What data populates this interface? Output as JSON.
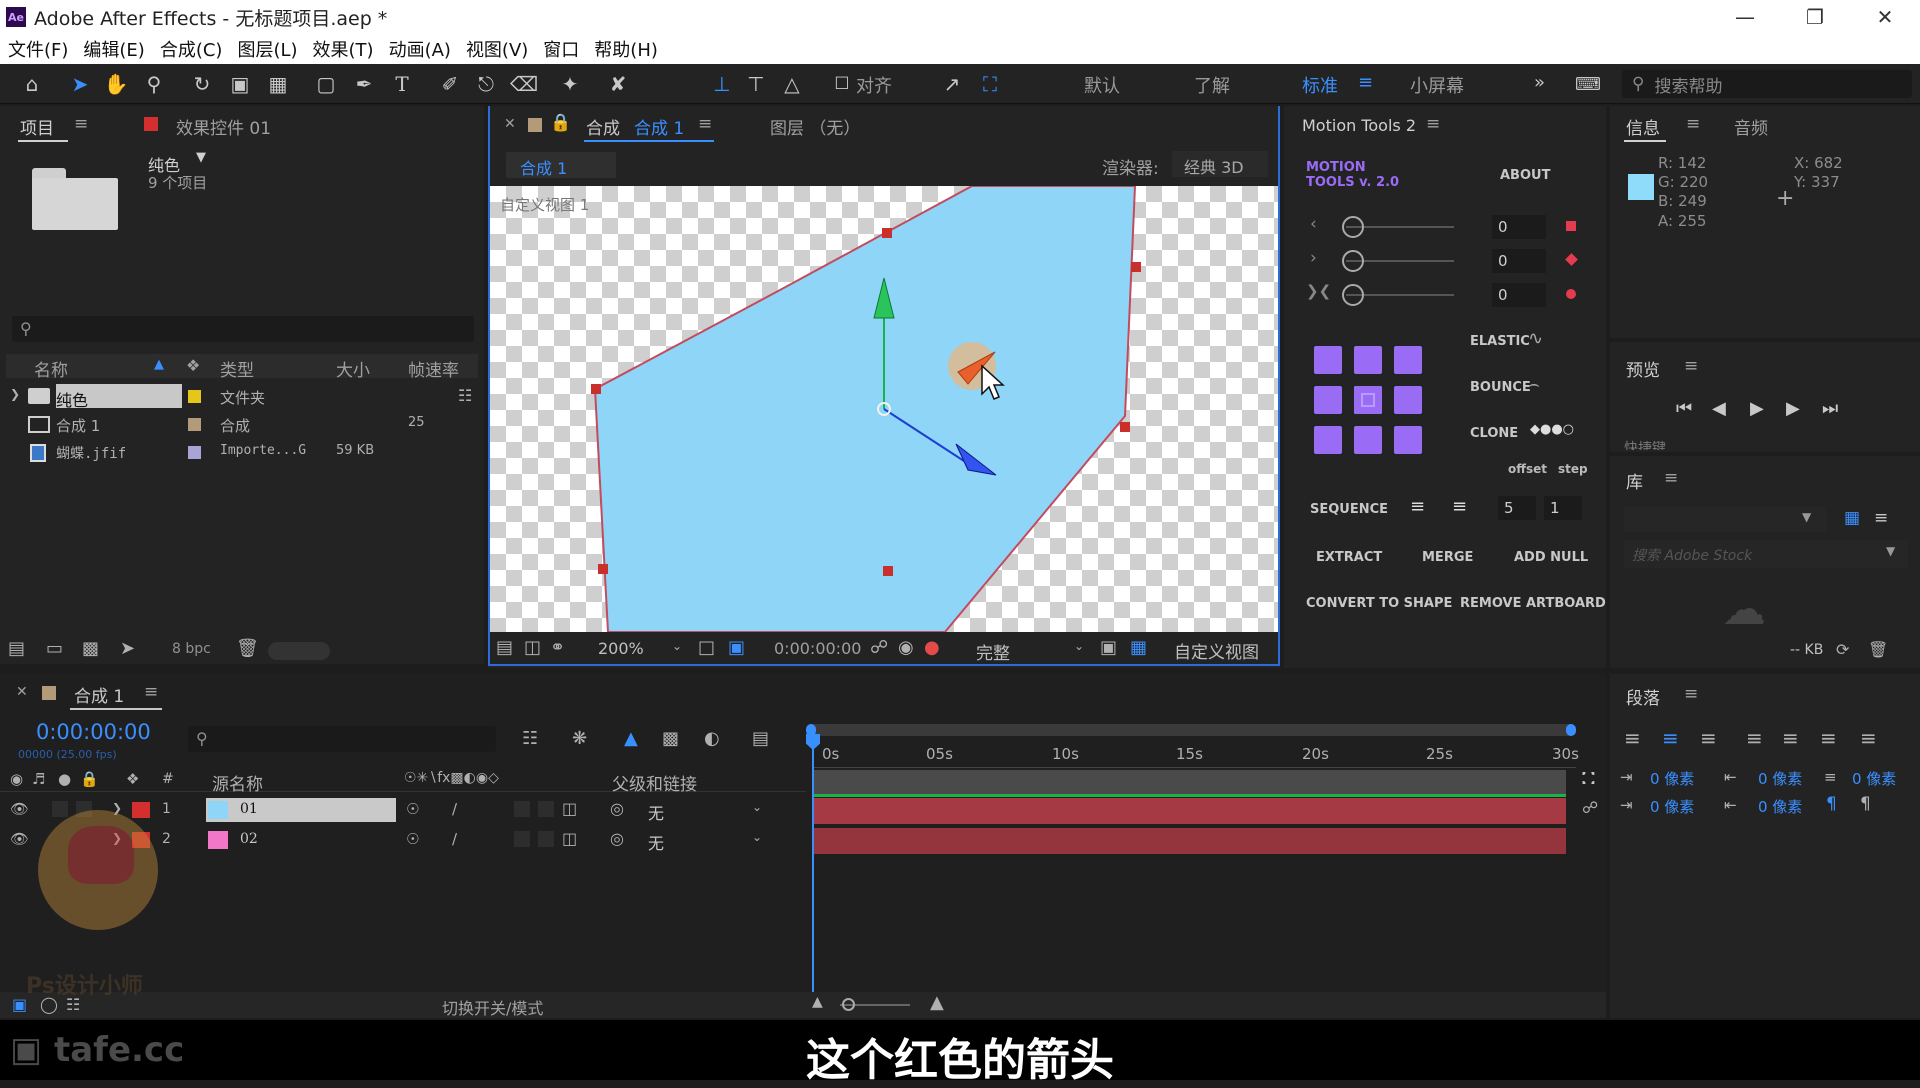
{
  "app": {
    "window_title": "Adobe After Effects - 无标题项目.aep *",
    "logo_text": "Ae",
    "window_buttons": [
      "minimize-icon",
      "restore-icon",
      "close-icon"
    ]
  },
  "menu": [
    "文件(F)",
    "编辑(E)",
    "合成(C)",
    "图层(L)",
    "效果(T)",
    "动画(A)",
    "视图(V)",
    "窗口",
    "帮助(H)"
  ],
  "toolbar": {
    "align_label": "对齐",
    "workspaces": [
      "默认",
      "了解",
      "标准",
      "小屏幕"
    ],
    "active_workspace": "标准",
    "more": "»",
    "help_placeholder": "搜索帮助"
  },
  "project_panel": {
    "tab_project": "项目",
    "tab_effects": "效果控件 01",
    "selected_name": "纯色",
    "selected_info": "9 个项目",
    "search_placeholder": "",
    "columns": [
      "名称",
      "类型",
      "大小",
      "帧速率"
    ],
    "items": [
      {
        "name": "纯色",
        "type": "文件夹",
        "size": "",
        "fps": "",
        "label_color": "#e6c619"
      },
      {
        "name": "合成 1",
        "type": "合成",
        "size": "",
        "fps": "25",
        "label_color": "#b39b7a"
      },
      {
        "name": "蝴蝶.jfif",
        "type": "Importe...G",
        "size": "59 KB",
        "fps": "",
        "label_color": "#a9a4d6"
      }
    ],
    "bpc": "8 bpc"
  },
  "comp_viewer": {
    "tab_label": "合成",
    "tab_comp_name": "合成 1",
    "layer_tab": "图层 （无）",
    "breadcrumb": "合成 1",
    "renderer_label": "渲染器:",
    "renderer_value": "经典 3D",
    "view_label": "自定义视图 1",
    "zoom": "200%",
    "timecode": "0:00:00:00",
    "resolution": "完整",
    "view_mode": "自定义视图",
    "layer_fill": "#8fd5f7"
  },
  "motion_tools": {
    "panel_title": "Motion Tools 2",
    "logo_line1": "MOTION",
    "logo_line2": "TOOLS v. 2.0",
    "about": "ABOUT",
    "sliders": [
      {
        "icon": "chevron-left-icon",
        "value": "0"
      },
      {
        "icon": "chevron-right-icon",
        "value": "0"
      },
      {
        "icon": "x-chevron-icon",
        "value": "0"
      }
    ],
    "elastic": "ELASTIC",
    "bounce": "BOUNCE",
    "clone": "CLONE",
    "offset": "offset",
    "step": "step",
    "sequence": "SEQUENCE",
    "seq_offset": "5",
    "seq_step": "1",
    "extract": "EXTRACT",
    "merge": "MERGE",
    "add_null": "ADD NULL",
    "convert_to_shape": "CONVERT TO SHAPE",
    "remove_artboard": "REMOVE ARTBOARD",
    "grid_color": "#9a6cf6"
  },
  "info_panel": {
    "tab_info": "信息",
    "tab_audio": "音频",
    "r": "R: 142",
    "g": "G: 220",
    "b": "B: 249",
    "a": "A: 255",
    "x": "X: 682",
    "y": "Y: 337",
    "swatch": "#8edcf9"
  },
  "preview_panel": {
    "title": "预览",
    "shortcut_partial": "快捷键"
  },
  "library_panel": {
    "title": "库",
    "search_placeholder": "搜索 Adobe Stock",
    "kb": "-- KB"
  },
  "paragraph_panel": {
    "title": "段落",
    "indent_values": [
      "0 像素",
      "0 像素",
      "0 像素",
      "0 像素",
      "0 像素"
    ]
  },
  "timeline": {
    "tab": "合成 1",
    "timecode": "0:00:00:00",
    "timecode_sub": "00000 (25.00 fps)",
    "columns": [
      "源名称",
      "父级和链接"
    ],
    "hash": "#",
    "ruler": [
      "0s",
      "05s",
      "10s",
      "15s",
      "20s",
      "25s",
      "30s"
    ],
    "layers": [
      {
        "num": "1",
        "name": "01",
        "parent": "无",
        "swatch": "#8fd5f7"
      },
      {
        "num": "2",
        "name": "02",
        "parent": "无",
        "swatch": "#f277c9"
      }
    ],
    "toggle_label": "切换开关/模式"
  },
  "overlay": {
    "watermark": "Ps设计小师",
    "site": "tafe.cc",
    "subtitle": "这个红色的箭头"
  }
}
